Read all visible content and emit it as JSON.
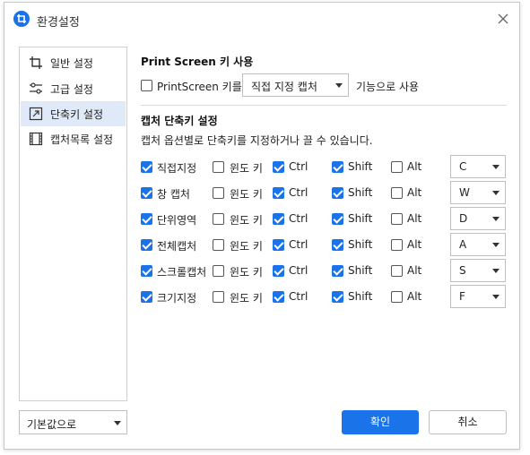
{
  "window": {
    "title": "환경설정",
    "accent": "#1a73e8"
  },
  "sidebar": {
    "items": [
      {
        "label": "일반 설정",
        "icon": "crop-icon"
      },
      {
        "label": "고급 설정",
        "icon": "sliders-icon"
      },
      {
        "label": "단축키 설정",
        "icon": "shortcut-icon",
        "active": true
      },
      {
        "label": "캡처목록 설정",
        "icon": "film-list-icon"
      }
    ],
    "reset_select": "기본값으로"
  },
  "print_screen": {
    "title": "Print Screen 키 사용",
    "checkbox_label": "PrintScreen 키를",
    "select_value": "직접 지정 캡처",
    "suffix": "기능으로 사용",
    "checked": false
  },
  "capture_shortcuts": {
    "title": "캡처 단축키 설정",
    "description": "캡처 옵션별로 단축키를 지정하거나 끌 수 있습니다.",
    "modifier_labels": {
      "win": "윈도 키",
      "ctrl": "Ctrl",
      "shift": "Shift",
      "alt": "Alt"
    },
    "rows": [
      {
        "name": "직접지정",
        "enabled": true,
        "win": false,
        "ctrl": true,
        "shift": true,
        "alt": false,
        "key": "C"
      },
      {
        "name": "창 캡처",
        "enabled": true,
        "win": false,
        "ctrl": true,
        "shift": true,
        "alt": false,
        "key": "W"
      },
      {
        "name": "단위영역",
        "enabled": true,
        "win": false,
        "ctrl": true,
        "shift": true,
        "alt": false,
        "key": "D"
      },
      {
        "name": "전체캡처",
        "enabled": true,
        "win": false,
        "ctrl": true,
        "shift": true,
        "alt": false,
        "key": "A"
      },
      {
        "name": "스크롤캡처",
        "enabled": true,
        "win": false,
        "ctrl": true,
        "shift": true,
        "alt": false,
        "key": "S"
      },
      {
        "name": "크기지정",
        "enabled": true,
        "win": false,
        "ctrl": true,
        "shift": true,
        "alt": false,
        "key": "F"
      }
    ]
  },
  "buttons": {
    "ok": "확인",
    "cancel": "취소"
  }
}
